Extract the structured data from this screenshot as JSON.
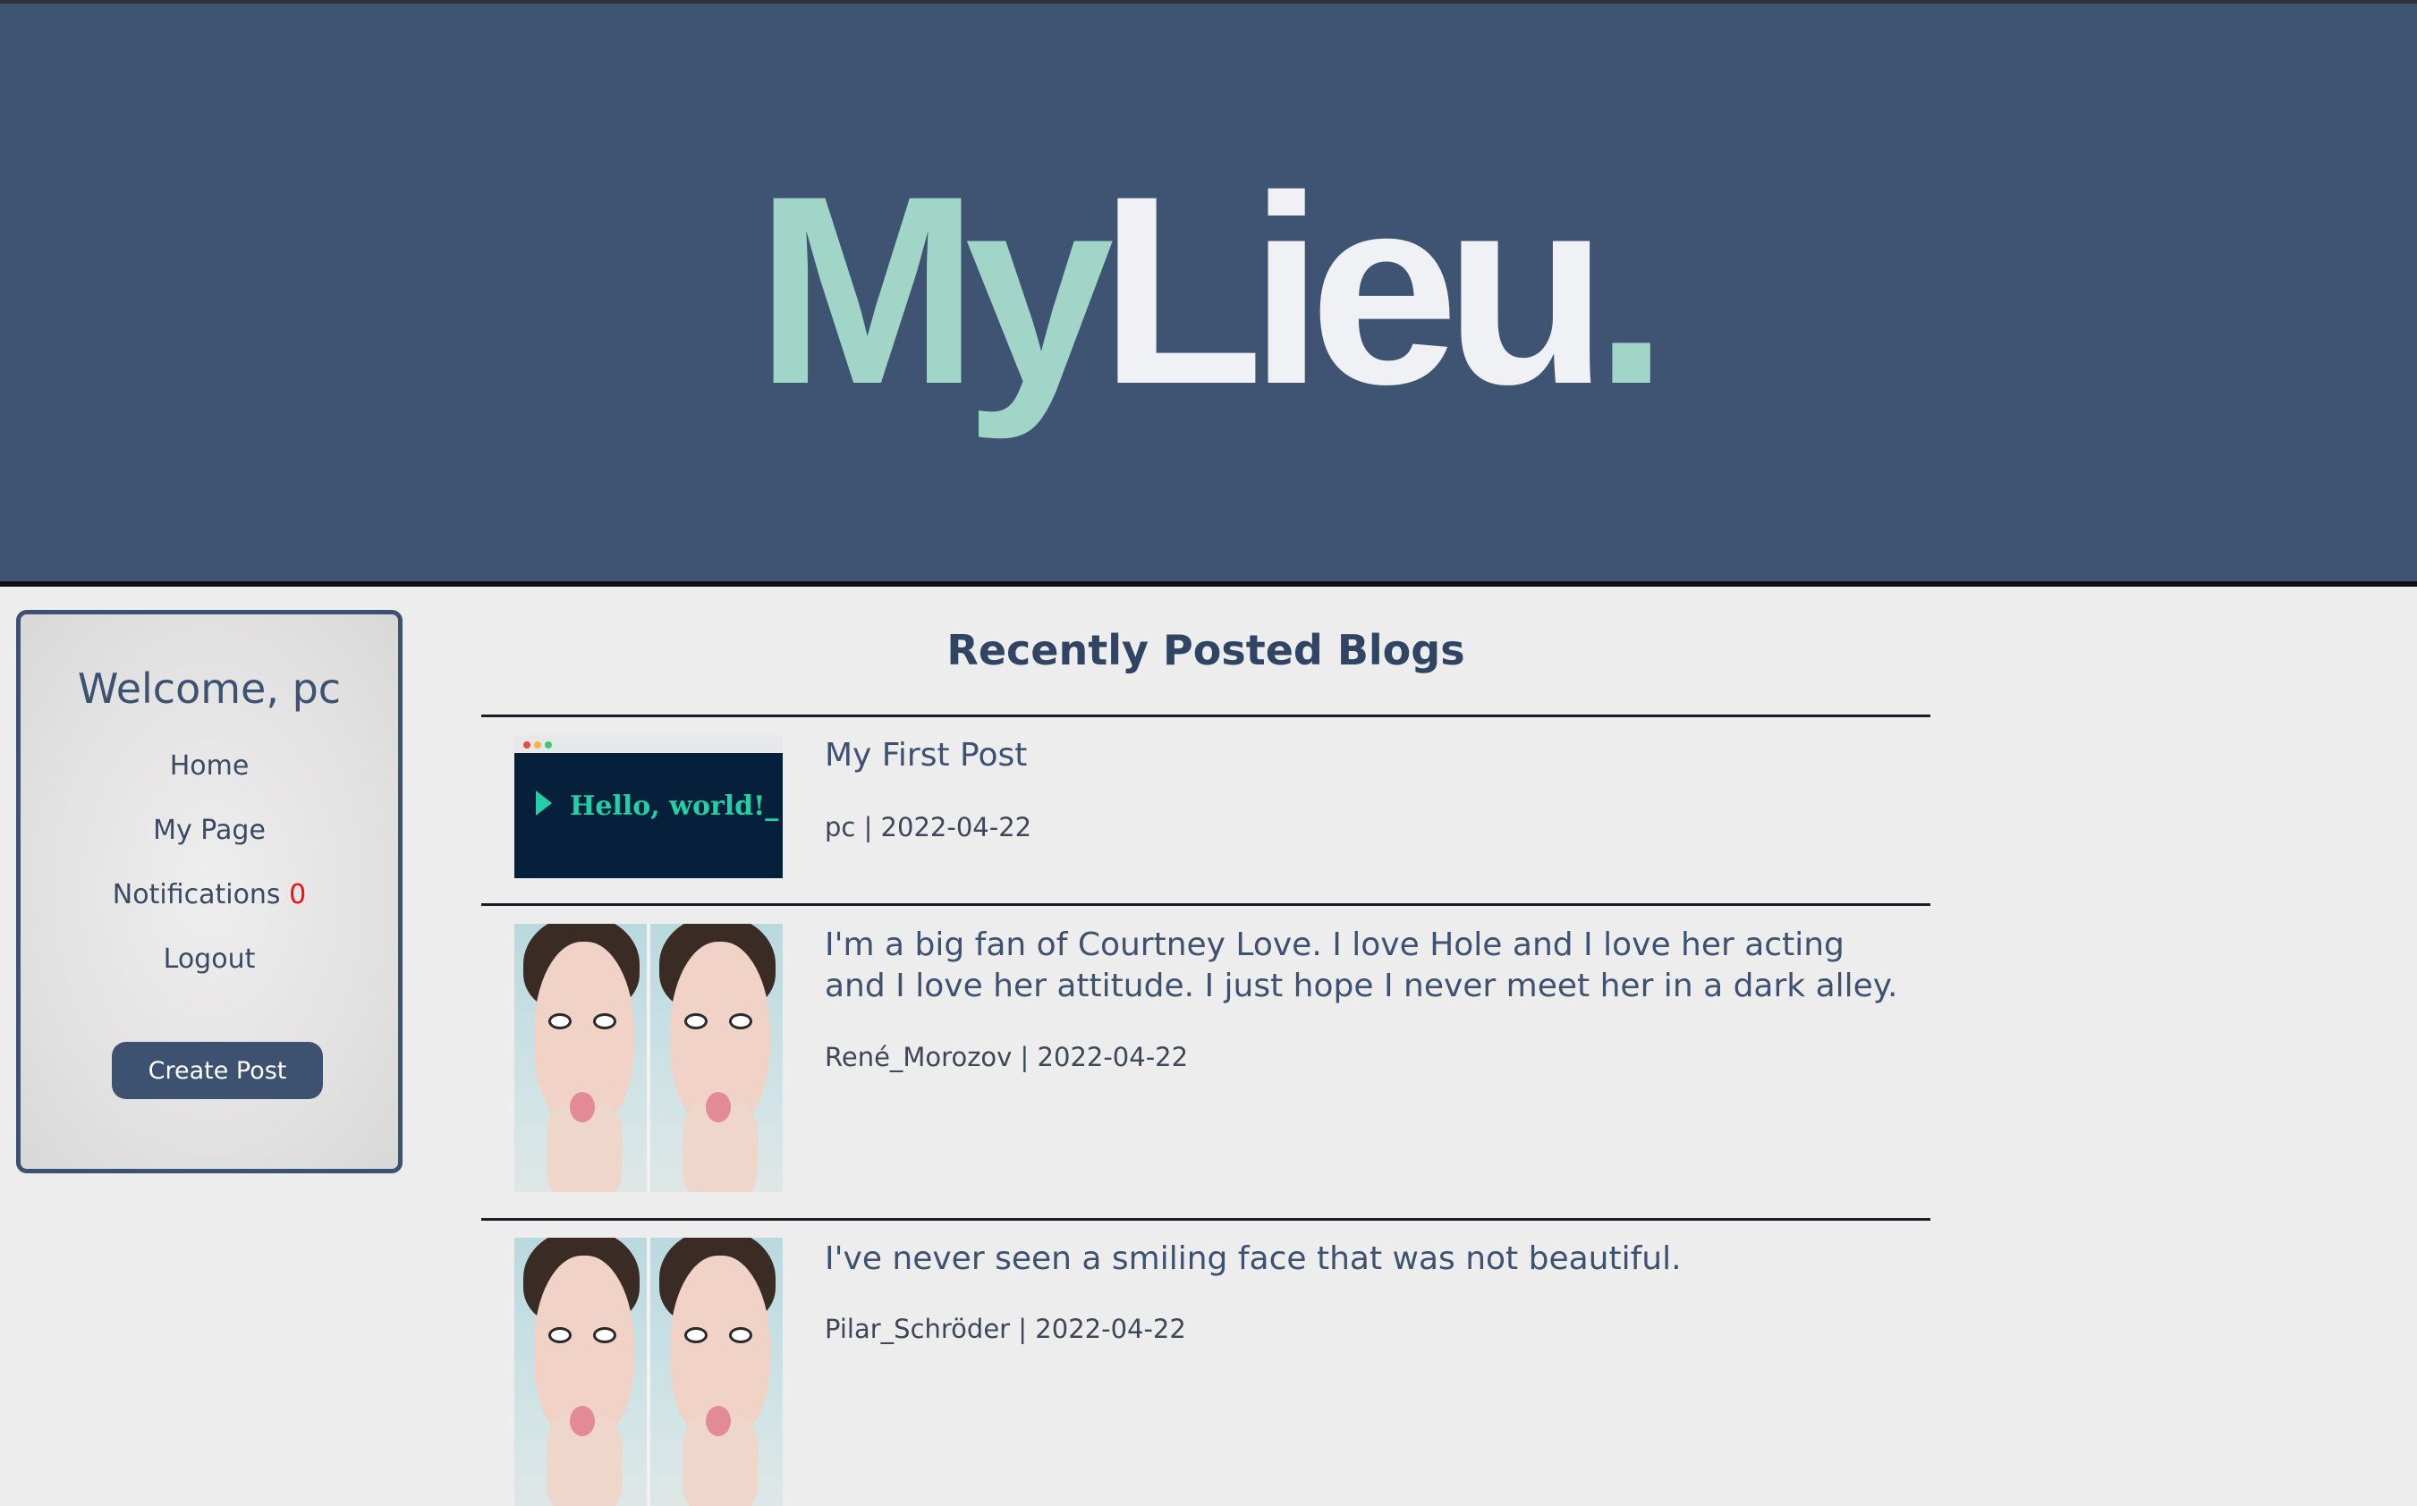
{
  "header": {
    "logo_my": "My",
    "logo_lieu": "Lieu",
    "logo_dot": "."
  },
  "sidebar": {
    "welcome": "Welcome, pc",
    "nav": {
      "home": "Home",
      "my_page": "My Page",
      "notifications": "Notifications",
      "notifications_count": "0",
      "logout": "Logout"
    },
    "create_post": "Create Post"
  },
  "main": {
    "title": "Recently Posted Blogs",
    "posts": [
      {
        "title": "My First Post",
        "meta": "pc | 2022-04-22",
        "thumb_text": "Hello, world!_"
      },
      {
        "title": "I'm a big fan of Courtney Love. I love Hole and I love her acting and I love her attitude. I just hope I never meet her in a dark alley.",
        "meta": "René_Morozov | 2022-04-22"
      },
      {
        "title": "I've never seen a smiling face that was not beautiful.",
        "meta": "Pilar_Schröder | 2022-04-22"
      }
    ]
  },
  "colors": {
    "header_bg": "#3f5472",
    "accent_mint": "#a0d5c7",
    "primary": "#3d5170",
    "notification_red": "#ef1111",
    "page_bg": "#ededed"
  }
}
